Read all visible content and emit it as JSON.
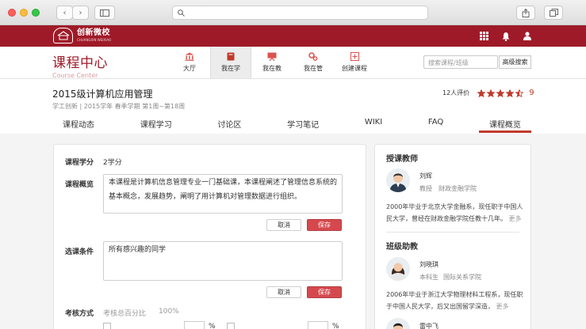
{
  "chrome": {
    "nav_back": "‹",
    "nav_forward": "›"
  },
  "topbar": {
    "logo_main": "创新微校",
    "logo_sub": "CHUANGXIN WEIXIAO"
  },
  "header": {
    "brand_title": "课程中心",
    "brand_sub": "Course Center",
    "nav": [
      {
        "label": "大厅",
        "icon": "bank-icon"
      },
      {
        "label": "我在学",
        "icon": "book-icon",
        "active": true
      },
      {
        "label": "我在教",
        "icon": "presentation-icon"
      },
      {
        "label": "我在管",
        "icon": "gears-icon"
      },
      {
        "label": "创建课程",
        "icon": "plus-square-icon"
      }
    ],
    "search_placeholder": "搜索课程/班级",
    "advanced_search": "高级搜索"
  },
  "course": {
    "title": "2015级计算机应用管理",
    "meta": "学工创新 | 2015学年 春季学期 第1周~第18周",
    "rating_count": "12人评价",
    "rating_score": "9",
    "rating_stars": 4.5
  },
  "tabs": [
    "课程动态",
    "课程学习",
    "讨论区",
    "学习笔记",
    "WIKI",
    "FAQ",
    "课程概览"
  ],
  "form": {
    "credit_label": "课程学分",
    "credit_value": "2学分",
    "overview_label": "课程概览",
    "overview_text": "本课程是计算机信息管理专业一门基础课，本课程阐述了管理信息系统的基本概念，发展趋势，阐明了用计算机对管理数据进行组织。",
    "cancel": "取消",
    "save": "保存",
    "prereq_label": "选课条件",
    "prereq_text": "所有感兴趣的同学",
    "assess_label": "考核方式",
    "assess_sub": "考核总百分比",
    "assess_total": "100%",
    "percent": "%"
  },
  "side": {
    "teacher_heading": "授课教师",
    "teacher_name": "刘辉",
    "teacher_title": "教授",
    "teacher_dept": "财政金融学院",
    "teacher_bio": "2000年毕业于北京大学金融系，现任职于中国人民大学，曾经在财政金融学院任教十几年。",
    "more": "更多",
    "assistant_heading": "班级助教",
    "assistant_name": "刘晓琪",
    "assistant_title": "本科生",
    "assistant_dept": "国际关系学院",
    "assistant_bio": "2006年毕业于浙江大学物理材料工程系，现任职于中国人民大学，后又出国留学深造，",
    "assistant2_name": "雷中飞"
  }
}
